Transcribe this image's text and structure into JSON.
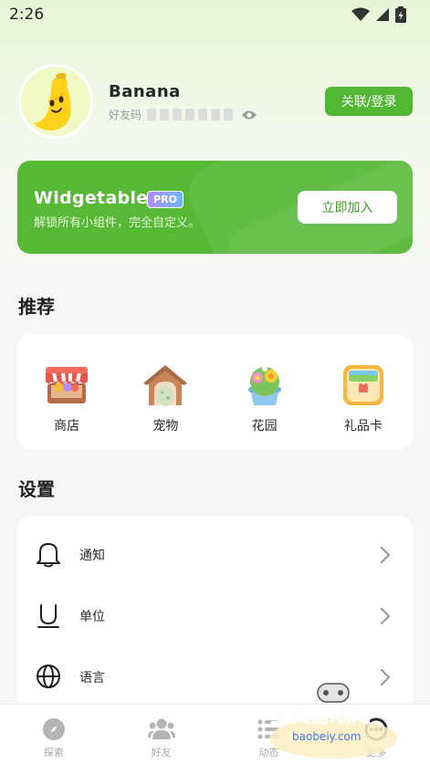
{
  "status_bar": {
    "time": "2:26"
  },
  "profile": {
    "username": "Banana",
    "friend_code_label": "好友码",
    "login_button": "关联/登录"
  },
  "pro_banner": {
    "title": "Widgetable",
    "badge": "PRO",
    "subtitle": "解锁所有小组件，完全自定义。",
    "join_button": "立即加入"
  },
  "recommended": {
    "title": "推荐",
    "items": [
      {
        "label": "商店",
        "icon": "shop-icon"
      },
      {
        "label": "宠物",
        "icon": "pet-house-icon"
      },
      {
        "label": "花园",
        "icon": "garden-flower-icon"
      },
      {
        "label": "礼品卡",
        "icon": "gift-card-icon"
      }
    ]
  },
  "settings": {
    "title": "设置",
    "items": [
      {
        "label": "通知",
        "icon": "bell-icon"
      },
      {
        "label": "单位",
        "icon": "unit-icon"
      },
      {
        "label": "语言",
        "icon": "globe-icon"
      }
    ]
  },
  "bottom_nav": {
    "items": [
      {
        "label": "探索",
        "icon": "compass-icon"
      },
      {
        "label": "好友",
        "icon": "friends-icon"
      },
      {
        "label": "动态",
        "icon": "feed-icon"
      },
      {
        "label": "更多",
        "icon": "more-icon"
      }
    ]
  },
  "watermark": {
    "text": "宝贝游戏网",
    "url_text": "baobeiy.com"
  },
  "colors": {
    "accent": "#51b833",
    "banner": "#57b836"
  }
}
